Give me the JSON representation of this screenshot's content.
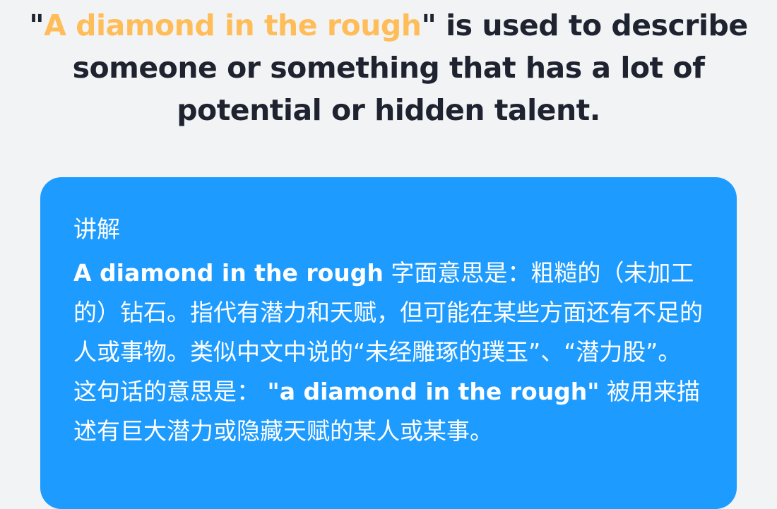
{
  "sentence": {
    "open_quote": "\"",
    "phrase": "A diamond in the rough",
    "rest": "\" is used to describe someone or something that has a lot of potential or hidden talent."
  },
  "card": {
    "title": "讲解",
    "explanation_phrase": "A diamond in the rough",
    "explanation_text": " 字面意思是：粗糙的（未加工的）钻石。指代有潜力和天赋，但可能在某些方面还有不足的人或事物。类似中文中说的“未经雕琢的璞玉”、“潜力股”。",
    "meaning_prefix": "这句话的意思是： ",
    "meaning_phrase": "\"a diamond in the rough\"",
    "meaning_text": " 被用来描述有巨大潜力或隐藏天赋的某人或某事。"
  },
  "colors": {
    "background": "#f2f3f5",
    "highlight": "#ffbd59",
    "card": "#1e9bff",
    "text_dark": "#1f2330",
    "text_light": "#ffffff"
  }
}
